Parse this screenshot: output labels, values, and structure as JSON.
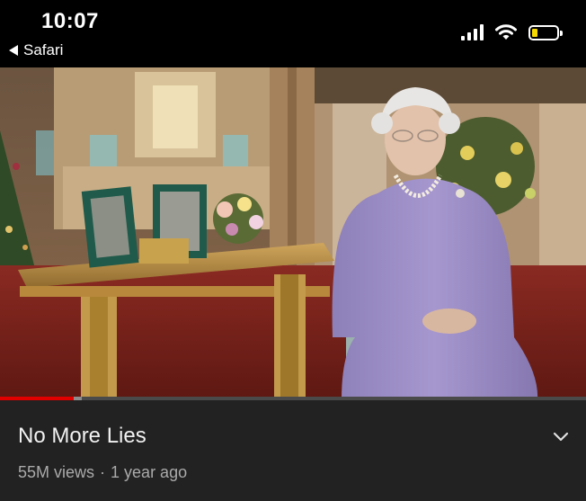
{
  "status_bar": {
    "time": "10:07",
    "back_app_label": "Safari",
    "battery_color": "#f5d800",
    "icons": [
      "back-triangle-icon",
      "cellular-signal-icon",
      "wifi-icon",
      "battery-icon"
    ]
  },
  "video": {
    "thumbnail_description_icon": "video-frame",
    "progress_fraction": 0.125,
    "buffer_fraction": 0.14,
    "progress_color": "#e00000"
  },
  "info": {
    "title": "No More Lies",
    "views": "55M views",
    "separator": "·",
    "age": "1 year ago",
    "expand_icon": "chevron-down-icon"
  }
}
